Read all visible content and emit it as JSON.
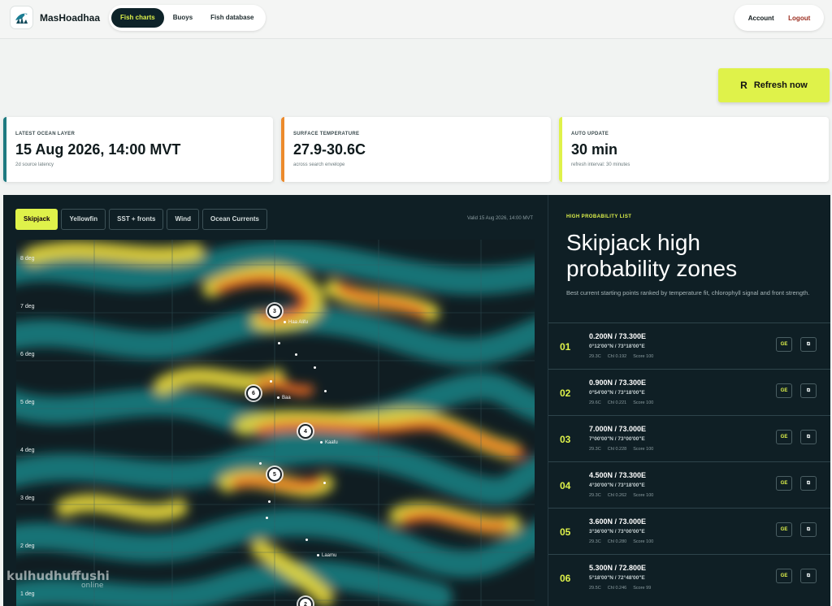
{
  "app": {
    "name": "MasHoadhaa"
  },
  "nav": {
    "items": [
      "Fish charts",
      "Buoys",
      "Fish database"
    ],
    "active": 0
  },
  "account": {
    "account_label": "Account",
    "logout_label": "Logout"
  },
  "refresh": {
    "icon": "R",
    "label": "Refresh now"
  },
  "stats": [
    {
      "label": "LATEST OCEAN LAYER",
      "value": "15 Aug 2026, 14:00 MVT",
      "sub": "2d source latency",
      "color": "#1e7a80"
    },
    {
      "label": "SURFACE TEMPERATURE",
      "value": "27.9-30.6C",
      "sub": "across search envelope",
      "color": "#ec8a2c"
    },
    {
      "label": "AUTO UPDATE",
      "value": "30 min",
      "sub": "refresh interval: 30 minutes",
      "color": "#dff24a"
    }
  ],
  "map": {
    "tabs": [
      "Skipjack",
      "Yellowfin",
      "SST + fronts",
      "Wind",
      "Ocean Currents"
    ],
    "active_tab": 0,
    "valid": "Valid 15 Aug 2026, 14:00 MVT",
    "lat_labels": [
      "8 deg",
      "7 deg",
      "6 deg",
      "5 deg",
      "4 deg",
      "3 deg",
      "2 deg",
      "1 deg"
    ],
    "places": [
      "Haa Alifu",
      "Baa",
      "Kaafu",
      "Laamu"
    ],
    "pins": [
      "3",
      "6",
      "4",
      "5",
      "2"
    ]
  },
  "watermark": {
    "line1": "kulhudhuffushi",
    "line2": "online"
  },
  "list": {
    "label": "HIGH PROBABILITY LIST",
    "title": "Skipjack high probability zones",
    "desc": "Best current starting points ranked by temperature fit, chlorophyll signal and front strength.",
    "ge_label": "GE",
    "rows": [
      {
        "rank": "01",
        "coord": "0.200N / 73.300E",
        "dms": "0°12'00\"N / 73°18'00\"E",
        "temp": "29.3C",
        "chl": "Chl 0.192",
        "score": "Score 100"
      },
      {
        "rank": "02",
        "coord": "0.900N / 73.300E",
        "dms": "0°54'00\"N / 73°18'00\"E",
        "temp": "29.6C",
        "chl": "Chl 0.221",
        "score": "Score 100"
      },
      {
        "rank": "03",
        "coord": "7.000N / 73.000E",
        "dms": "7°00'00\"N / 73°00'00\"E",
        "temp": "29.3C",
        "chl": "Chl 0.228",
        "score": "Score 100"
      },
      {
        "rank": "04",
        "coord": "4.500N / 73.300E",
        "dms": "4°30'00\"N / 73°18'00\"E",
        "temp": "29.3C",
        "chl": "Chl 0.262",
        "score": "Score 100"
      },
      {
        "rank": "05",
        "coord": "3.600N / 73.000E",
        "dms": "3°36'00\"N / 73°00'00\"E",
        "temp": "29.3C",
        "chl": "Chl 0.280",
        "score": "Score 100"
      },
      {
        "rank": "06",
        "coord": "5.300N / 72.800E",
        "dms": "5°18'00\"N / 72°48'00\"E",
        "temp": "29.5C",
        "chl": "Chl 0.246",
        "score": "Score 99"
      }
    ]
  },
  "colors": {
    "accent": "#dff24a",
    "panel": "#0f1f25",
    "nav_active": "#0e2329",
    "logout": "#9b2c1e"
  }
}
